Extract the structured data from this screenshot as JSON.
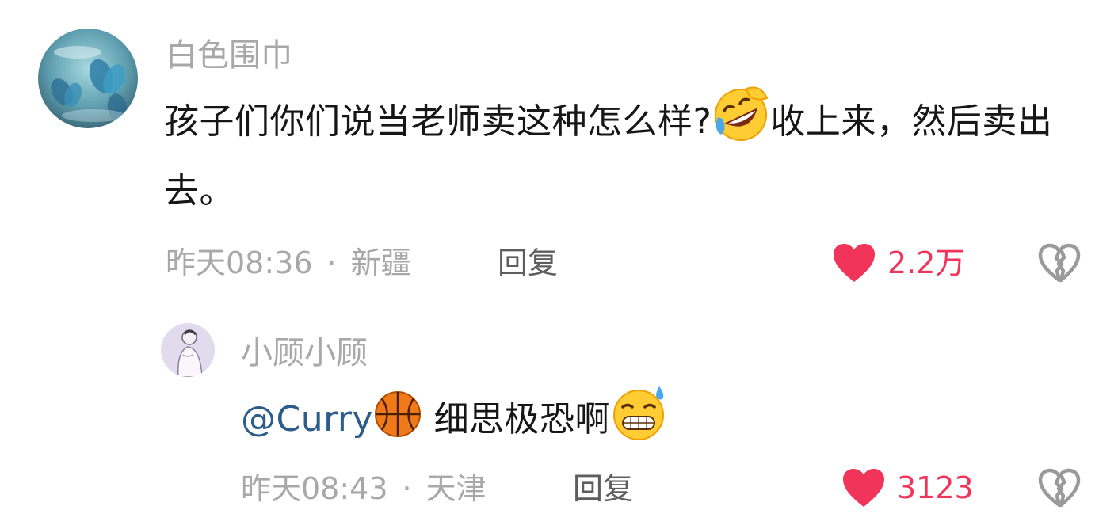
{
  "comments": [
    {
      "username": "白色围巾",
      "text_part1": "孩子们你们说当老师卖这种怎么样?",
      "emoji1": "rolling-on-floor-laughing-emoji",
      "text_part2": "收上来，然后卖出去。",
      "time": "昨天08:36",
      "location": "新疆",
      "reply_label": "回复",
      "likes": "2.2万",
      "dot": "·"
    },
    {
      "username": "小顾小顾",
      "mention": "@Curry",
      "emoji_mention": "basketball-emoji",
      "text": "细思极恐啊",
      "emoji2": "grinning-sweat-emoji",
      "time": "昨天08:43",
      "location": "天津",
      "reply_label": "回复",
      "likes": "3123",
      "dot": "·"
    }
  ],
  "colors": {
    "like_red": "#f0345a",
    "mention_blue": "#2c5c8a",
    "meta_gray": "#a8a8a8"
  }
}
